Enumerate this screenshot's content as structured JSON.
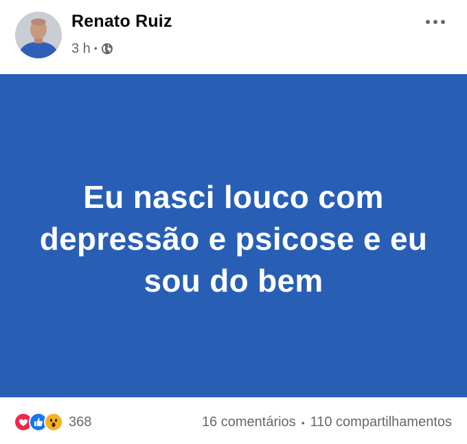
{
  "post": {
    "author": "Renato Ruiz",
    "timestamp": "3 h",
    "separator": "•",
    "audience_icon": "globe-icon",
    "more_icon": "more-horizontal-icon",
    "text": "Eu nasci louco com depressão e psicose e eu sou do bem",
    "background_color": "#285fb5",
    "text_color": "#ffffff"
  },
  "footer": {
    "reaction_icons": [
      "love-reaction-icon",
      "like-reaction-icon",
      "wow-reaction-icon"
    ],
    "reaction_count": "368",
    "comments": "16 comentários",
    "separator": "•",
    "shares": "110 compartilhamentos"
  }
}
